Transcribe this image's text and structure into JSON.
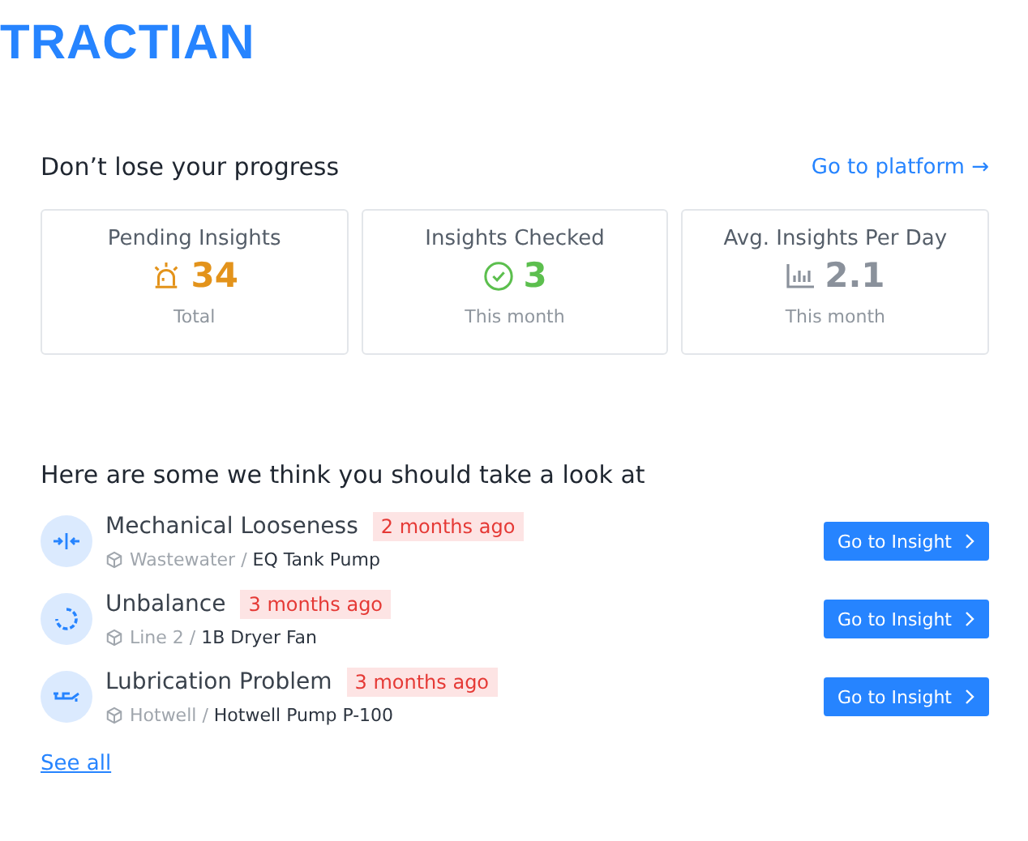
{
  "logo": {
    "text": "TRACTIAN"
  },
  "progress": {
    "title": "Don’t lose your progress",
    "link": "Go to platform →",
    "stats": [
      {
        "label": "Pending Insights",
        "kind": "alarm",
        "value": "34",
        "caption": "Total",
        "color": "#e3931b"
      },
      {
        "label": "Insights Checked",
        "kind": "check",
        "value": "3",
        "caption": "This month",
        "color": "#5cbf4e"
      },
      {
        "label": "Avg. Insights Per Day",
        "kind": "chart",
        "value": "2.1",
        "caption": "This month",
        "color": "#8a919b"
      }
    ]
  },
  "insights": {
    "title": "Here are some we think you should take a look at",
    "items": [
      {
        "kind": "looseness",
        "name": "Mechanical Looseness",
        "age": "2 months ago",
        "location": "Wastewater",
        "separator": "/",
        "asset": "EQ Tank Pump",
        "button": "Go to Insight"
      },
      {
        "kind": "unbalance",
        "name": "Unbalance",
        "age": "3 months ago",
        "location": "Line 2",
        "separator": "/",
        "asset": "1B Dryer Fan",
        "button": "Go to Insight"
      },
      {
        "kind": "lubrication",
        "name": "Lubrication Problem",
        "age": "3 months ago",
        "location": "Hotwell",
        "separator": "/",
        "asset": "Hotwell Pump P-100",
        "button": "Go to Insight"
      }
    ],
    "see_all": "See all"
  }
}
